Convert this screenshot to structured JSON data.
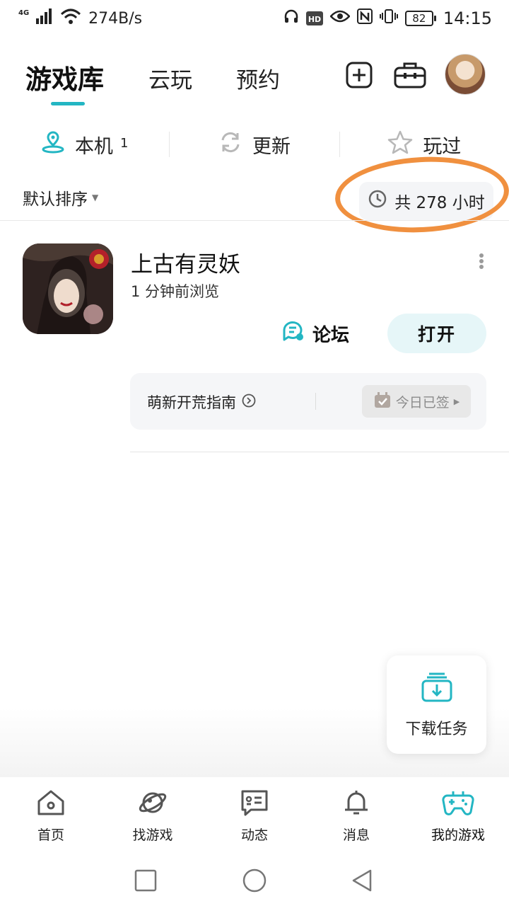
{
  "status_bar": {
    "network": "4G",
    "speed": "274B/s",
    "battery": "82",
    "time": "14:15"
  },
  "header": {
    "tab_library": "游戏库",
    "tab_cloud": "云玩",
    "tab_reserve": "预约"
  },
  "filters": {
    "local": "本机",
    "local_count": "1",
    "update": "更新",
    "played": "玩过"
  },
  "sort": {
    "label": "默认排序",
    "total_time": "共 278 小时"
  },
  "game": {
    "title": "上古有灵妖",
    "subtitle": "1 分钟前浏览",
    "forum": "论坛",
    "open": "打开",
    "guide": "萌新开荒指南",
    "checkin": "今日已签"
  },
  "fab": {
    "download": "下载任务"
  },
  "nav": {
    "items": [
      "首页",
      "找游戏",
      "动态",
      "消息",
      "我的游戏"
    ]
  },
  "colors": {
    "accent": "#23b6c3",
    "highlight": "#f0903f"
  }
}
